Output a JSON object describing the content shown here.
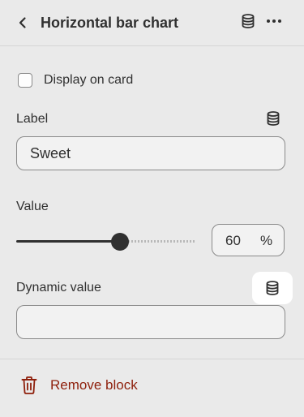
{
  "header": {
    "title": "Horizontal bar chart",
    "back_icon": "chevron-left-icon",
    "database_icon": "database-icon",
    "more_icon": "more-horizontal-icon"
  },
  "display_on_card": {
    "label": "Display on card",
    "checked": false
  },
  "label_field": {
    "label": "Label",
    "value": "Sweet",
    "icon": "database-icon"
  },
  "value_field": {
    "label": "Value",
    "value": "60",
    "unit": "%",
    "slider_fraction": 0.6
  },
  "dynamic_value": {
    "label": "Dynamic value",
    "value": "",
    "icon": "database-icon"
  },
  "remove": {
    "label": "Remove block",
    "icon": "trash-icon",
    "color": "#8e1f0b"
  }
}
